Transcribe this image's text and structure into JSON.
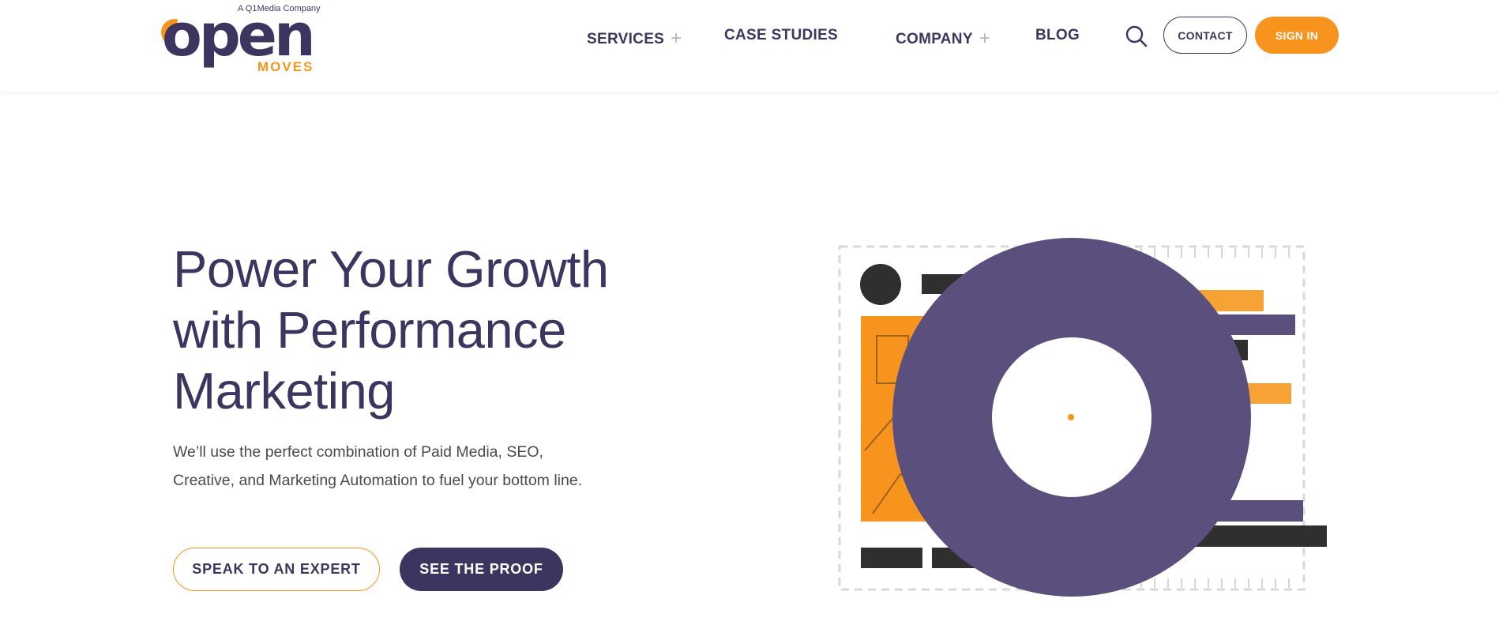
{
  "header": {
    "logo": {
      "tagline": "A Q1Media Company",
      "wordmark": "open",
      "submark": "MOVES"
    },
    "nav": [
      {
        "label": "SERVICES",
        "has_submenu": true
      },
      {
        "label": "CASE STUDIES",
        "has_submenu": false
      },
      {
        "label": "COMPANY",
        "has_submenu": true
      },
      {
        "label": "BLOG",
        "has_submenu": false
      }
    ],
    "submenu_symbol": "+",
    "search_icon": "search-icon",
    "contact_label": "CONTACT",
    "signin_label": "SIGN IN"
  },
  "hero": {
    "title_line1": "Power Your Growth",
    "title_line2": "with Performance",
    "title_line3": "Marketing",
    "subtitle_line1": "We’ll use the perfect combination of Paid Media, SEO,",
    "subtitle_line2": "Creative, and Marketing Automation to fuel your bottom line.",
    "cta_expert": "SPEAK TO AN EXPERT",
    "cta_proof": "SEE THE PROOF"
  },
  "colors": {
    "brand_purple": "#3d3560",
    "brand_orange": "#f7941d",
    "ring_purple": "#5a4f7d",
    "bar_dark": "#2f2f2f"
  }
}
